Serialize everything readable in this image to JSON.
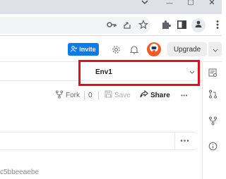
{
  "window_controls": {
    "minimize_glyph": "—",
    "maximize_glyph": "▢",
    "close_glyph": "✕"
  },
  "browser_toolbar": {
    "icons": [
      "key-icon",
      "share-icon",
      "star-icon",
      "extension-icon",
      "sidepanel-icon",
      "profile-icon",
      "kebab-menu-icon"
    ]
  },
  "app_header": {
    "invite_label": "Invite",
    "upgrade_label": "Upgrade",
    "brand_color": "#097bed"
  },
  "environment": {
    "selected": "Env1",
    "highlight_color": "#e0101c"
  },
  "actions": {
    "fork_label": "Fork",
    "fork_count": "0",
    "save_label": "Save",
    "share_label": "Share",
    "more_label": "•••"
  },
  "url_row": {
    "more_label": "•••"
  },
  "partial_text": "c5bbeeaebe"
}
